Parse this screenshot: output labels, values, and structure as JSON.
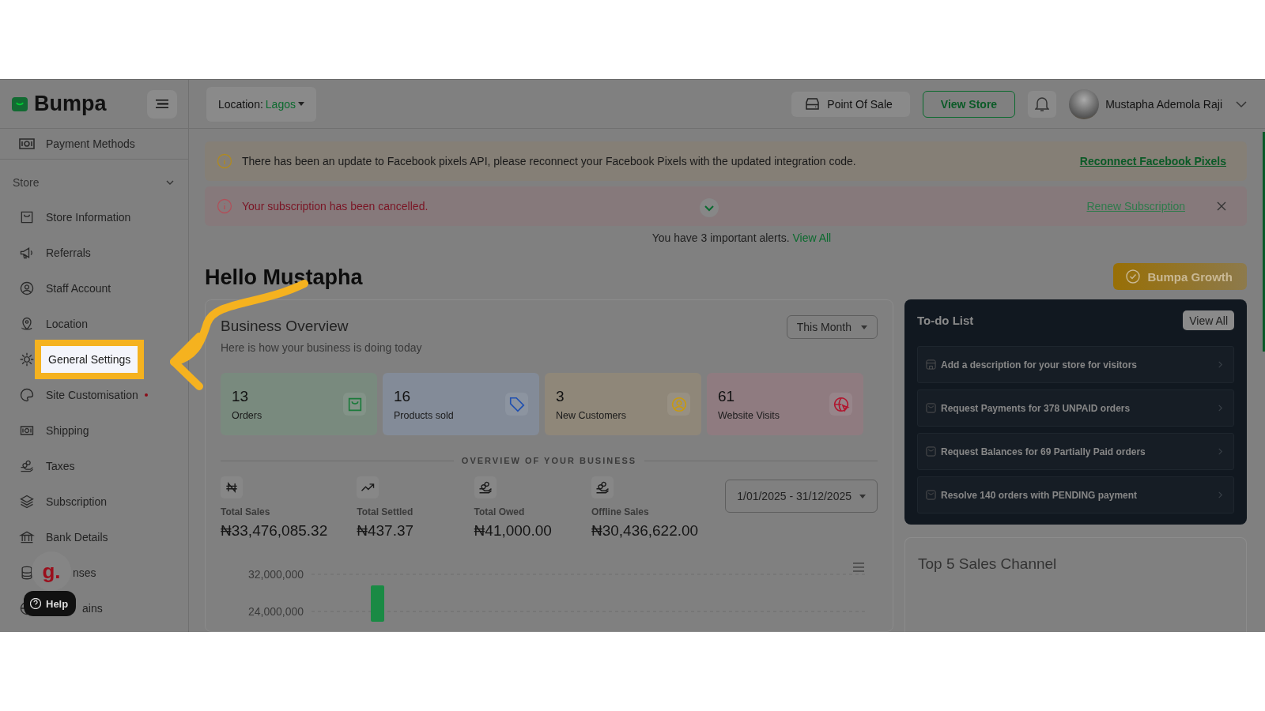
{
  "brand": {
    "name": "Bumpa"
  },
  "sidebar": {
    "top_items": [
      {
        "label": "Payment Methods"
      }
    ],
    "section": {
      "label": "Store",
      "expanded": true
    },
    "items": [
      {
        "label": "Store Information",
        "alert_dot": false,
        "highlighted": false
      },
      {
        "label": "Referrals",
        "alert_dot": false,
        "highlighted": false
      },
      {
        "label": "Staff Account",
        "alert_dot": false,
        "highlighted": false
      },
      {
        "label": "Location",
        "alert_dot": false,
        "highlighted": false
      },
      {
        "label": "General Settings",
        "alert_dot": false,
        "highlighted": true
      },
      {
        "label": "Site Customisation",
        "alert_dot": true,
        "highlighted": false
      },
      {
        "label": "Shipping",
        "alert_dot": false,
        "highlighted": false
      },
      {
        "label": "Taxes",
        "alert_dot": false,
        "highlighted": false
      },
      {
        "label": "Subscription",
        "alert_dot": false,
        "highlighted": false
      },
      {
        "label": "Bank Details",
        "alert_dot": false,
        "highlighted": false
      },
      {
        "label": "nses",
        "alert_dot": false,
        "highlighted": false
      },
      {
        "label": "ains",
        "alert_dot": false,
        "highlighted": false
      }
    ]
  },
  "help_widget": {
    "logo": "g.",
    "label": "Help"
  },
  "header": {
    "location_label": "Location:",
    "location_value": "Lagos",
    "pos_button": "Point Of Sale",
    "view_store_button": "View Store",
    "user_name": "Mustapha Ademola Raji"
  },
  "alerts": [
    {
      "kind": "warning",
      "text": "There has been an update to Facebook pixels API, please reconnect your Facebook Pixels with the updated integration code.",
      "link": "Reconnect Facebook Pixels",
      "closable": false
    },
    {
      "kind": "error",
      "text": "Your subscription has been cancelled.",
      "link": "Renew Subscription",
      "closable": true
    }
  ],
  "alerts_summary": {
    "text": "You have 3 important alerts.",
    "link": "View All"
  },
  "greeting": "Hello Mustapha",
  "growth_button": "Bumpa Growth",
  "overview": {
    "title": "Business Overview",
    "subtitle": "Here is how your business is doing today",
    "period": "This Month",
    "stats": [
      {
        "value": "13",
        "label": "Orders",
        "color": "#1a7a3a"
      },
      {
        "value": "16",
        "label": "Products sold",
        "color": "#2050b0"
      },
      {
        "value": "3",
        "label": "New Customers",
        "color": "#c89a10"
      },
      {
        "value": "61",
        "label": "Website Visits",
        "color": "#b01830"
      }
    ],
    "section_label": "OVERVIEW OF YOUR BUSINESS",
    "metrics": [
      {
        "label": "Total Sales",
        "value": "₦33,476,085.32"
      },
      {
        "label": "Total Settled",
        "value": "₦437.37"
      },
      {
        "label": "Total Owed",
        "value": "₦41,000.00"
      },
      {
        "label": "Offline Sales",
        "value": "₦30,436,622.00"
      }
    ],
    "date_range": "1/01/2025 - 31/12/2025",
    "chart_data": {
      "type": "bar",
      "values": [
        29600000
      ],
      "ylim": [
        21800000,
        32000000
      ],
      "yticks": [
        {
          "value": 24000000,
          "label": "24,000,000"
        },
        {
          "value": 32000000,
          "label": "32,000,000"
        }
      ]
    }
  },
  "todo": {
    "title": "To-do List",
    "view_all": "View All",
    "items": [
      {
        "text": "Add a description for your store for visitors"
      },
      {
        "text": "Request Payments for 378 UNPAID orders"
      },
      {
        "text": "Request Balances for 69 Partially Paid orders"
      },
      {
        "text": "Resolve 140 orders with PENDING payment"
      }
    ]
  },
  "top_channels": {
    "title": "Top 5 Sales Channel"
  }
}
